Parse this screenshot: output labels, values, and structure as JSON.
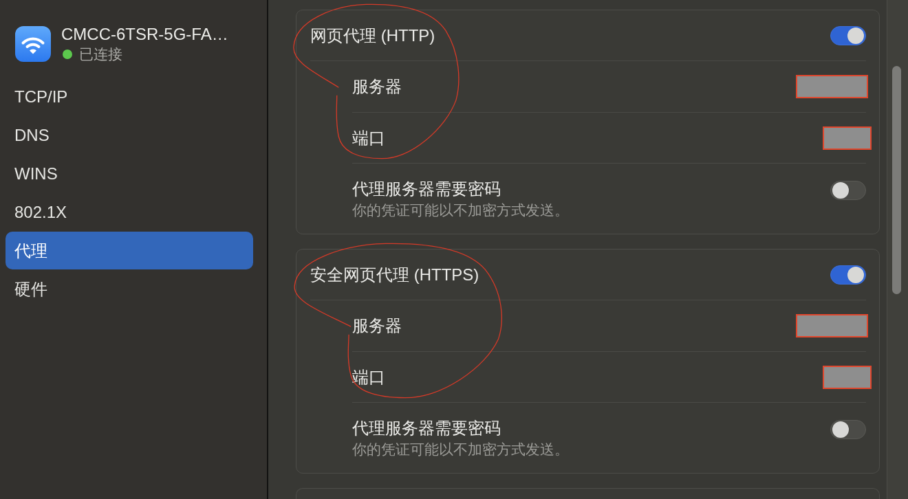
{
  "sidebar": {
    "network": {
      "name": "CMCC-6TSR-5G-FA…",
      "status": "已连接",
      "connected": true
    },
    "items": [
      {
        "label": "TCP/IP",
        "selected": false
      },
      {
        "label": "DNS",
        "selected": false
      },
      {
        "label": "WINS",
        "selected": false
      },
      {
        "label": "802.1X",
        "selected": false
      },
      {
        "label": "代理",
        "selected": true
      },
      {
        "label": "硬件",
        "selected": false
      }
    ]
  },
  "cards": [
    {
      "kind": "proxy",
      "title": "网页代理 (HTTP)",
      "on": true,
      "circled": true,
      "fields": [
        {
          "kind": "host",
          "label": "服务器",
          "redacted": true
        },
        {
          "kind": "port",
          "label": "端口",
          "redacted": true
        }
      ],
      "auth": {
        "label": "代理服务器需要密码",
        "note": "你的凭证可能以不加密方式发送。",
        "on": false
      }
    },
    {
      "kind": "proxy",
      "title": "安全网页代理 (HTTPS)",
      "on": true,
      "circled": true,
      "fields": [
        {
          "kind": "host",
          "label": "服务器",
          "redacted": true
        },
        {
          "kind": "port",
          "label": "端口",
          "redacted": true
        }
      ],
      "auth": {
        "label": "代理服务器需要密码",
        "note": "你的凭证可能以不加密方式发送。",
        "on": false
      }
    },
    {
      "kind": "cut-off"
    }
  ]
}
